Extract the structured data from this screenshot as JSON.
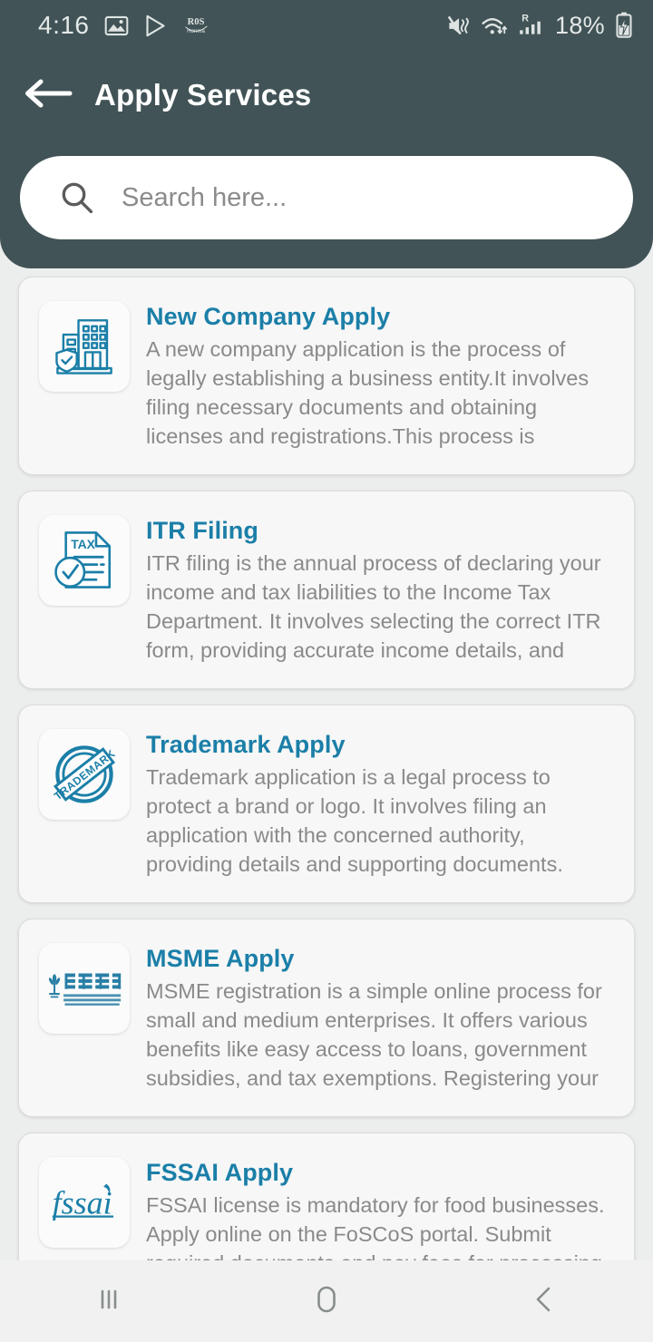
{
  "status_bar": {
    "time": "4:16",
    "battery_percent": "18%",
    "left_icons": [
      "gallery-image-icon",
      "play-store-icon",
      "ros-honma-app-icon"
    ],
    "right_icons": [
      "mute-vibrate-icon",
      "wifi-data-transfer-icon",
      "roaming-signal-bars-icon",
      "battery-charging-icon"
    ]
  },
  "header": {
    "title": "Apply Services",
    "back_icon": "arrow-left-icon",
    "background_color": "#415356"
  },
  "search": {
    "placeholder": "Search here...",
    "value": "",
    "icon": "search-icon"
  },
  "theme": {
    "accent": "#1b7fa8",
    "header_bg": "#415356",
    "page_bg": "#eceded",
    "card_bg": "#f7f7f7",
    "body_text": "#8a8a8a"
  },
  "services": [
    {
      "title": "New Company Apply",
      "description": "A new company application is the process of legally establishing a business entity.It involves filing necessary documents and obtaining licenses and registrations.This process is typically governed by the Companies Act and",
      "icon": "company-building-shield-icon"
    },
    {
      "title": "ITR Filing",
      "description": "ITR filing is the annual process of declaring your income and tax liabilities to the Income Tax Department. It involves selecting the correct ITR form, providing accurate income details, and submitting the return",
      "icon": "tax-document-check-icon"
    },
    {
      "title": "Trademark Apply",
      "description": "Trademark application is a legal process to protect a brand or logo. It involves filing an application with the concerned authority, providing details and supporting documents. Successful registration grants exclusive",
      "icon": "trademark-stamp-icon"
    },
    {
      "title": "MSME Apply",
      "description": "MSME registration is a simple online process for small and medium enterprises. It offers various benefits like easy access to loans, government subsidies, and tax exemptions. Registering your business as an MSME",
      "icon": "msme-logo-icon"
    },
    {
      "title": "FSSAI Apply",
      "description": "FSSAI license is mandatory for food businesses. Apply online on the FoSCoS portal. Submit required documents and pay fees for processing.",
      "icon": "fssai-logo-icon"
    }
  ],
  "navbar": {
    "recents_icon": "recents-bars-icon",
    "home_icon": "home-circle-icon",
    "back_icon": "back-chevron-icon"
  }
}
